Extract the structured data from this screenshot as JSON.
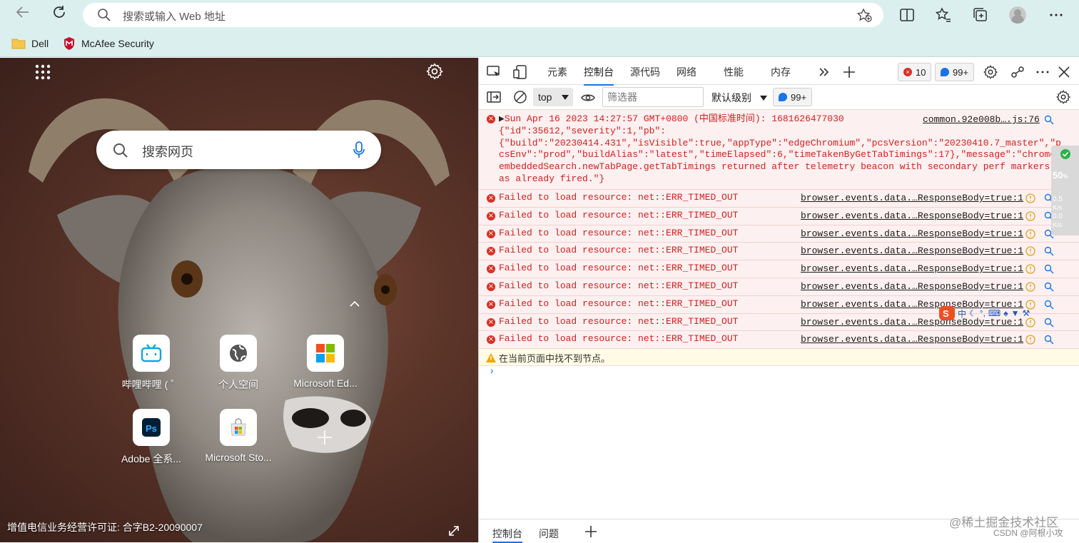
{
  "browser": {
    "address_placeholder": "搜索或输入 Web 地址",
    "bookmarks": [
      {
        "label": "Dell"
      },
      {
        "label": "McAfee Security"
      }
    ]
  },
  "ntp": {
    "search_placeholder": "搜索网页",
    "tiles": [
      {
        "label": "哔哩哔哩 ( ゜"
      },
      {
        "label": "个人空间"
      },
      {
        "label": "Microsoft Ed..."
      },
      {
        "label": "Adobe 全系..."
      },
      {
        "label": "Microsoft Sto..."
      }
    ],
    "license": "增值电信业务经营许可证: 合字B2-20090007"
  },
  "devtools": {
    "tabs": [
      "元素",
      "控制台",
      "源代码",
      "网络",
      "性能",
      "内存"
    ],
    "error_count": "10",
    "message_count": "99+",
    "context": "top",
    "filter_placeholder": "筛选器",
    "levels": "默认级别",
    "toolbar_count": "99+",
    "first_message": {
      "timestamp": "Sun Apr 16 2023 14:27:57 GMT+0800 (中国标准时间): 1681626477030",
      "body": "{\"id\":35612,\"severity\":1,\"pb\":\n{\"build\":\"20230414.431\",\"isVisible\":true,\"appType\":\"edgeChromium\",\"pcsVersion\":\"20230410.7_master\",\"pcsEnv\":\"prod\",\"buildAlias\":\"latest\",\"timeElapsed\":6,\"timeTakenByGetTabTimings\":17},\"message\":\"chrome.embeddedSearch.newTabPage.getTabTimings returned after telemetry beacon with secondary perf markers has already fired.\"}",
      "source": "common.92e008b….js:76"
    },
    "errors": [
      {
        "text": "Failed to load resource: net::ERR_TIMED_OUT",
        "source": "browser.events.data.…ResponseBody=true:1"
      },
      {
        "text": "Failed to load resource: net::ERR_TIMED_OUT",
        "source": "browser.events.data.…ResponseBody=true:1"
      },
      {
        "text": "Failed to load resource: net::ERR_TIMED_OUT",
        "source": "browser.events.data.…ResponseBody=true:1"
      },
      {
        "text": "Failed to load resource: net::ERR_TIMED_OUT",
        "source": "browser.events.data.…ResponseBody=true:1"
      },
      {
        "text": "Failed to load resource: net::ERR_TIMED_OUT",
        "source": "browser.events.data.…ResponseBody=true:1"
      },
      {
        "text": "Failed to load resource: net::ERR_TIMED_OUT",
        "source": "browser.events.data.…ResponseBody=true:1"
      },
      {
        "text": "Failed to load resource: net::ERR_TIMED_OUT",
        "source": "browser.events.data.…ResponseBody=true:1"
      },
      {
        "text": "Failed to load resource: net::ERR_TIMED_OUT",
        "source": "browser.events.data.…ResponseBody=true:1"
      },
      {
        "text": "Failed to load resource: net::ERR_TIMED_OUT",
        "source": "browser.events.data.…ResponseBody=true:1"
      }
    ],
    "warning": "在当前页面中找不到节点。",
    "prompt": "›",
    "drawer_tabs": [
      "控制台",
      "问题"
    ]
  },
  "overlays": {
    "perf_percent": "50",
    "perf_percent_unit": "%",
    "perf_up": "0.5",
    "perf_up_unit": "K/s",
    "perf_down": "0.0",
    "perf_down_unit": "K/s",
    "ime_label": "中",
    "watermark": "@稀土掘金技术社区",
    "watermark2": "CSDN @阿根小攻"
  },
  "colors": {
    "chrome_bg": "#dcefef",
    "error_bg": "#fdf0f0",
    "error_text": "#d21f1f",
    "warning_bg": "#fffbe5",
    "accent": "#1a73e8"
  }
}
